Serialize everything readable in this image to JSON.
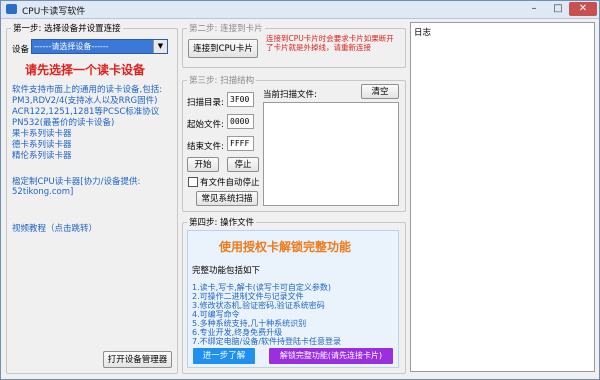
{
  "window": {
    "title": "CPU卡读写软件",
    "minimize": "–",
    "maximize": "□",
    "close": "✕",
    "icon": "cpu-card-icon"
  },
  "step1": {
    "legend": "第一步: 选择设备并设置连接",
    "device_label": "设备",
    "device_select": "------请选择设备------",
    "device_arrow": "▼",
    "prompt": "请先选择一个读卡设备",
    "info_lines": [
      "软件支持市面上的通用的读卡设备,包括:",
      "PM3,RDV2/4(支持冰人以及RRG固件)",
      "ACR122,1251,1281等PCSC标准协议",
      "PN532(最善价的读卡设备)",
      "果卡系列读卡器",
      "德卡系列读卡器",
      "精伦系列读卡器",
      "",
      "楹定制CPU读卡器[协力/设备提供:",
      "52tikong.com]"
    ],
    "video_link": "视频教程（点击跳转）",
    "open_device_manager": "打开设备管理器"
  },
  "step2": {
    "legend": "第二步: 连接到卡片",
    "connect_button": "连接到CPU卡片",
    "hint": "连接到CPU卡片时会要求卡片如果断开了卡片就是外掉线，请重新连接"
  },
  "step3": {
    "legend": "第三步: 扫描结构",
    "scan_dir_label": "扫描目录:",
    "scan_dir_value": "3F00",
    "start_file_label": "起始文件:",
    "start_file_value": "0000",
    "end_file_label": "结束文件:",
    "end_file_value": "FFFF",
    "start_button": "开始",
    "stop_button": "停止",
    "auto_stop_label": "有文件自动停止",
    "common_scan_button": "常见系统扫描",
    "current_file_label": "当前扫描文件:",
    "clear_button": "清空"
  },
  "step4": {
    "legend": "第四步: 操作文件",
    "headline": "使用授权卡解锁完整功能",
    "features_title": "完整功能包括如下",
    "features": [
      "1.读卡,写卡,解卡(读写卡可自定义参数)",
      "2.可操作二进制文件与记录文件",
      "3.修改状态机,验证密码,验证系统密码",
      "4.可编写命令",
      "5.多种系统支持,几十种系统识别",
      "6.专业开发,终身免费升级",
      "7.不绑定电脑/设备/软件持登陆卡任意登录"
    ],
    "learn_more_button": "进一步了解",
    "unlock_button": "解锁完整功能(请先连接卡片)"
  },
  "log": {
    "title": "日志"
  },
  "colors": {
    "accent_blue": "#1f64c8",
    "alert_red": "#e0211d",
    "headline_orange": "#f07a1a",
    "learn_more_bg": "#1f8ff0",
    "unlock_bg": "#9a2fe0"
  }
}
